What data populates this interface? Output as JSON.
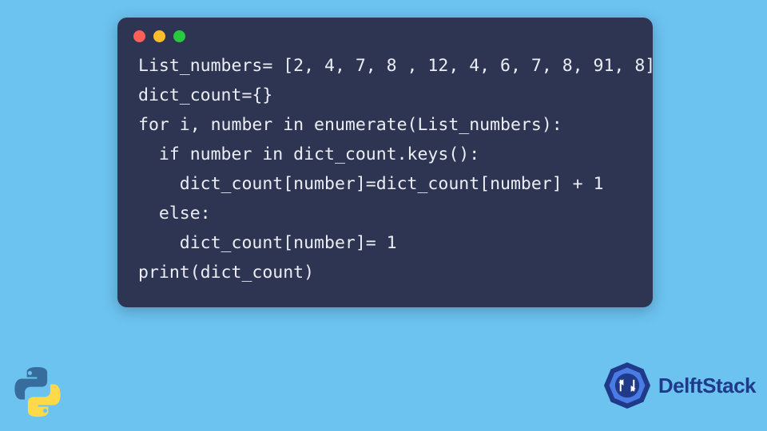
{
  "code": {
    "lines": [
      "List_numbers= [2, 4, 7, 8 , 12, 4, 6, 7, 8, 91, 8]",
      "dict_count={}",
      "for i, number in enumerate(List_numbers):",
      "  if number in dict_count.keys():",
      "    dict_count[number]=dict_count[number] + 1",
      "  else:",
      "    dict_count[number]= 1",
      "print(dict_count)"
    ]
  },
  "brand": {
    "delftstack": "DelftStack"
  },
  "colors": {
    "page_bg": "#6cc3f0",
    "window_bg": "#2e3552",
    "code_fg": "#eceef5",
    "ctl_red": "#ff5f56",
    "ctl_yellow": "#ffbd2e",
    "ctl_green": "#27c93f",
    "delft_blue": "#203a8a",
    "python_blue": "#366d9c",
    "python_yellow": "#ffd94a"
  }
}
